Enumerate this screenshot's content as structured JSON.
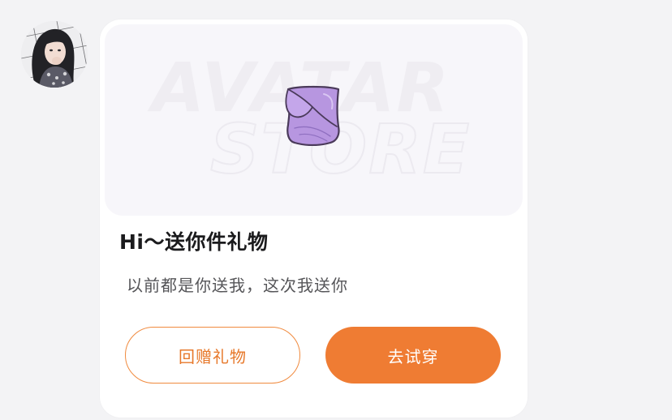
{
  "card": {
    "watermark_line1": "AVATAR",
    "watermark_line2": "STORE",
    "title": "Hi～送你件礼物",
    "subtitle": "以前都是你送我，这次我送你",
    "return_gift_label": "回赠礼物",
    "try_on_label": "去试穿"
  },
  "gift_item": {
    "icon": "purple-tube-top-icon",
    "color": "#b796e0"
  },
  "colors": {
    "accent": "#ef7c33",
    "outline_text": "#e7782a"
  }
}
